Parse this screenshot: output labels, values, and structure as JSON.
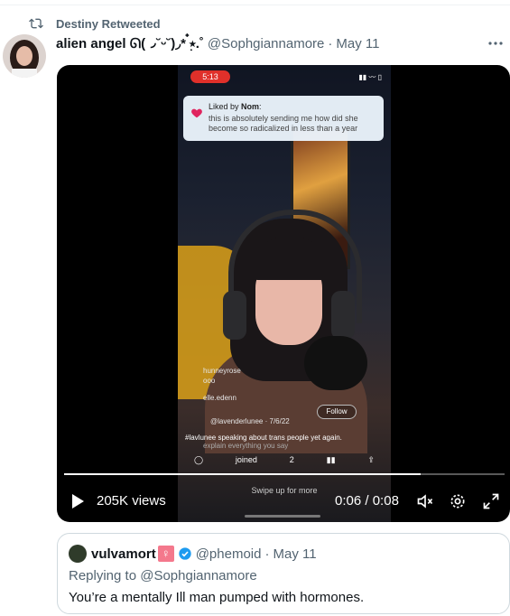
{
  "retweet": {
    "icon": "retweet-icon",
    "label": "Destiny Retweeted"
  },
  "tweet": {
    "display_name": "alien angel ᘏ(◞˘ᵕ˘)◞* ๋࣭⭑.˚",
    "handle": "@Sophgiannamore",
    "separator": "·",
    "date": "May 11",
    "more_icon": "more-horizontal-icon"
  },
  "video": {
    "status_time": "5:13",
    "status_icons": "▮▮ 〰 ▯",
    "notification": {
      "liked_prefix": "Liked by ",
      "liked_name": "Nom",
      "liked_suffix": ":",
      "message": "this is absolutely sending me how did she become so radicalized in less than a year"
    },
    "overlay": {
      "user1": "hunneyrose",
      "user1_sub": "ooo",
      "user2": "elle.edenn",
      "quote_user": "@lavenderlunee · 7/6/22",
      "follow_label": "Follow",
      "caption": "#lavlunee speaking about trans people yet again.",
      "subcaption": "explain everything you say",
      "likes": "2",
      "joined_text": "joined"
    },
    "swipe_text": "Swipe up for more",
    "views": "205K views",
    "elapsed": "0:06",
    "duration": "0:08",
    "progress_fraction": 0.81,
    "icons": {
      "play": "play-icon",
      "mute": "volume-muted-icon",
      "settings": "settings-gear-icon",
      "fullscreen": "fullscreen-icon"
    }
  },
  "quote": {
    "display_name": "vulvamort",
    "badge": "♀",
    "handle": "@phemoid",
    "separator": "·",
    "date": "May 11",
    "replying_to_prefix": "Replying to ",
    "replying_to_handle": "@Sophgiannamore",
    "text": "You’re a mentally Ill man pumped with hormones."
  },
  "colors": {
    "accent": "#1d9bf0",
    "secondary_text": "#536471",
    "border": "#cfd9de"
  }
}
